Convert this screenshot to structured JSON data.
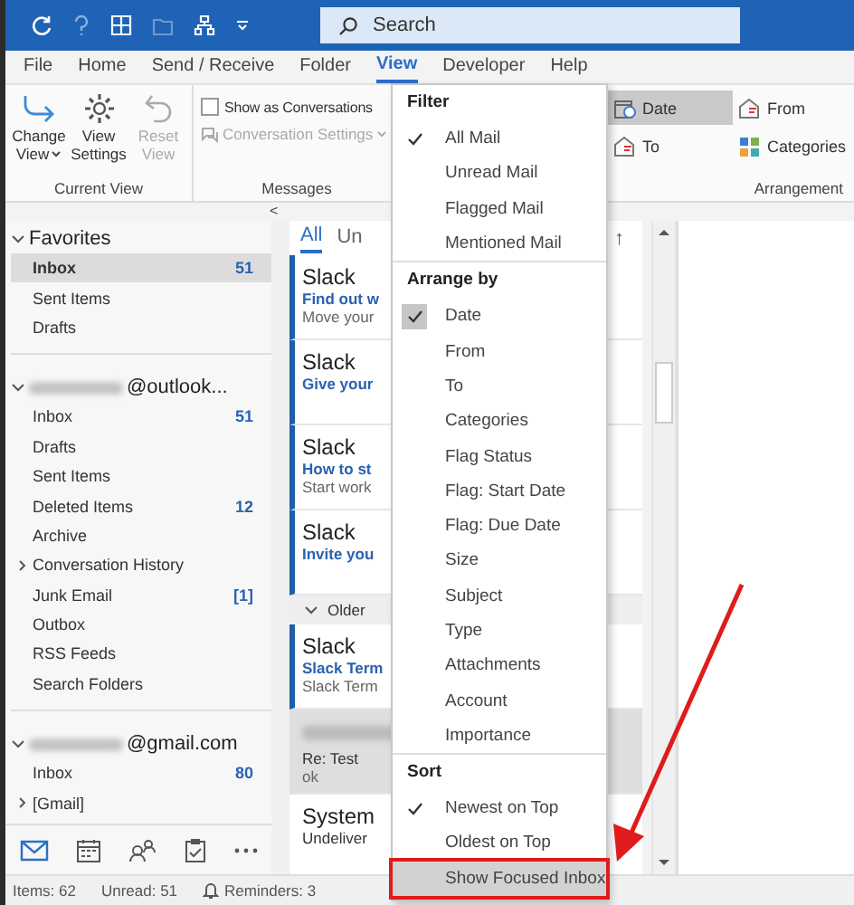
{
  "title_bar": {
    "search": {
      "placeholder": "Search"
    }
  },
  "menu_tabs": [
    {
      "label": "File",
      "selected": false
    },
    {
      "label": "Home",
      "selected": false
    },
    {
      "label": "Send / Receive",
      "selected": false
    },
    {
      "label": "Folder",
      "selected": false
    },
    {
      "label": "View",
      "selected": true
    },
    {
      "label": "Developer",
      "selected": false
    },
    {
      "label": "Help",
      "selected": false
    }
  ],
  "ribbon": {
    "current_view": {
      "label": "Current View",
      "buttons": [
        {
          "kind": "change",
          "label": "Change View",
          "dropdown": true,
          "disabled": false
        },
        {
          "kind": "settings",
          "label": "View Settings",
          "dropdown": false,
          "disabled": false
        },
        {
          "kind": "reset",
          "label": "Reset View",
          "dropdown": false,
          "disabled": true
        }
      ]
    },
    "messages": {
      "label": "Messages",
      "show_as_conversations": {
        "label": "Show as Conversations",
        "checked": false
      },
      "conversation_settings": {
        "label": "Conversation Settings",
        "disabled": true
      }
    },
    "arrangement": {
      "label": "Arrangement",
      "options": [
        {
          "kind": "date",
          "label": "Date",
          "selected": true
        },
        {
          "kind": "from",
          "label": "From",
          "selected": false
        },
        {
          "kind": "to",
          "label": "To",
          "selected": false
        },
        {
          "kind": "categories",
          "label": "Categories",
          "selected": false
        }
      ]
    }
  },
  "collapse_button": "<",
  "folder_pane": {
    "sections": [
      {
        "label": "Favorites",
        "redacted": false,
        "expanded": true,
        "children": [
          {
            "label": "Inbox",
            "count": "51",
            "selected": true
          },
          {
            "label": "Sent Items",
            "selected": false
          },
          {
            "label": "Drafts",
            "selected": false
          }
        ]
      },
      {
        "label": "@outlook...",
        "redacted": true,
        "expanded": true,
        "children": [
          {
            "label": "Inbox",
            "count": "51",
            "selected": false
          },
          {
            "label": "Drafts",
            "selected": false
          },
          {
            "label": "Sent Items",
            "selected": false
          },
          {
            "label": "Deleted Items",
            "count": "12",
            "selected": false
          },
          {
            "label": "Archive",
            "selected": false
          },
          {
            "label": "Conversation History",
            "expanded": false,
            "selected": false
          },
          {
            "label": "Junk Email",
            "count": "[1]",
            "selected": false
          },
          {
            "label": "Outbox",
            "selected": false
          },
          {
            "label": "RSS Feeds",
            "selected": false
          },
          {
            "label": "Search Folders",
            "selected": false
          }
        ]
      },
      {
        "label": "@gmail.com",
        "redacted": true,
        "expanded": true,
        "children": [
          {
            "label": "Inbox",
            "count": "80",
            "selected": false
          },
          {
            "label": "[Gmail]",
            "expanded": false,
            "selected": false
          }
        ]
      }
    ]
  },
  "nav_bar": [
    {
      "kind": "mail",
      "selected": true
    },
    {
      "kind": "calendar",
      "selected": false
    },
    {
      "kind": "people",
      "selected": false
    },
    {
      "kind": "tasks",
      "selected": false
    },
    {
      "kind": "more",
      "selected": false
    }
  ],
  "message_list": {
    "tabs": [
      {
        "label": "All",
        "selected": true
      },
      {
        "label": "Un",
        "selected": false
      }
    ],
    "sort_arrow": "↑",
    "items": [
      {
        "kind": "message",
        "sender": "Slack",
        "subject": "Find out w",
        "preview": "Move your",
        "unread": true,
        "selected": false
      },
      {
        "kind": "message",
        "sender": "Slack",
        "subject": "Give your",
        "unread": true,
        "selected": false
      },
      {
        "kind": "message",
        "sender": "Slack",
        "subject": "How to st",
        "preview": "Start work",
        "unread": true,
        "selected": false
      },
      {
        "kind": "message",
        "sender": "Slack",
        "subject": "Invite you",
        "unread": true,
        "selected": false
      },
      {
        "kind": "group",
        "label": "Older",
        "expanded": true
      },
      {
        "kind": "message",
        "sender": "Slack",
        "subject": "Slack Term",
        "preview": "Slack Term",
        "unread": true,
        "selected": false
      },
      {
        "kind": "message",
        "sender_redacted": true,
        "subject": "Re: Test",
        "preview": "ok",
        "unread": false,
        "selected": true
      },
      {
        "kind": "message",
        "sender": "System",
        "subject": "Undeliver",
        "unread": false,
        "selected": false
      }
    ]
  },
  "view_menu": {
    "sections": [
      {
        "kind": "filter",
        "header": "Filter",
        "items": [
          {
            "label": "All Mail",
            "checked": true,
            "highlighted": false
          },
          {
            "label": "Unread Mail",
            "checked": false,
            "highlighted": false
          },
          {
            "label": "Flagged Mail",
            "checked": false,
            "highlighted": false
          },
          {
            "label": "Mentioned Mail",
            "checked": false,
            "highlighted": false
          }
        ]
      },
      {
        "kind": "arrange",
        "header": "Arrange by",
        "items": [
          {
            "label": "Date",
            "checked": true,
            "highlighted": false
          },
          {
            "label": "From",
            "checked": false,
            "highlighted": false
          },
          {
            "label": "To",
            "checked": false,
            "highlighted": false
          },
          {
            "label": "Categories",
            "checked": false,
            "highlighted": false
          },
          {
            "label": "Flag Status",
            "checked": false,
            "highlighted": false
          },
          {
            "label": "Flag: Start Date",
            "checked": false,
            "highlighted": false
          },
          {
            "label": "Flag: Due Date",
            "checked": false,
            "highlighted": false
          },
          {
            "label": "Size",
            "checked": false,
            "highlighted": false
          },
          {
            "label": "Subject",
            "checked": false,
            "highlighted": false
          },
          {
            "label": "Type",
            "checked": false,
            "highlighted": false
          },
          {
            "label": "Attachments",
            "checked": false,
            "highlighted": false
          },
          {
            "label": "Account",
            "checked": false,
            "highlighted": false
          },
          {
            "label": "Importance",
            "checked": false,
            "highlighted": false
          }
        ]
      },
      {
        "kind": "sort",
        "header": "Sort",
        "items": [
          {
            "label": "Newest on Top",
            "checked": true,
            "highlighted": false
          },
          {
            "label": "Oldest on Top",
            "checked": false,
            "highlighted": false
          },
          {
            "label": "Show Focused Inbox",
            "checked": false,
            "highlighted": true
          }
        ]
      }
    ]
  },
  "status_bar": {
    "items": "Items: 62",
    "unread": "Unread: 51",
    "reminders": "Reminders: 3"
  },
  "annotation": {
    "kind": "arrow"
  }
}
